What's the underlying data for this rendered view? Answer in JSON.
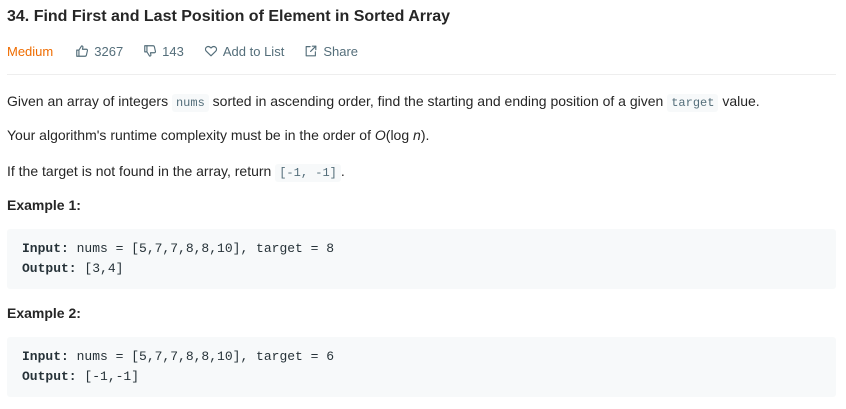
{
  "problem": {
    "title": "34. Find First and Last Position of Element in Sorted Array",
    "difficulty": "Medium",
    "likes": "3267",
    "dislikes": "143",
    "add_to_list": "Add to List",
    "share": "Share"
  },
  "description": {
    "p1": {
      "pre": "Given an array of integers ",
      "code1": "nums",
      "mid": " sorted in ascending order, find the starting and ending position of a given ",
      "code2": "target",
      "post": " value."
    },
    "p2": {
      "pre": "Your algorithm's runtime complexity must be in the order of ",
      "o": "O",
      "mid": "(log ",
      "n": "n",
      "post": ")."
    },
    "p3": {
      "pre": "If the target is not found in the array, return ",
      "code": "[-1, -1]",
      "post": "."
    }
  },
  "examples": [
    {
      "heading": "Example 1:",
      "input_label": "Input:",
      "input_value": " nums = [5,7,7,8,8,10], target = 8",
      "output_label": "Output:",
      "output_value": " [3,4]"
    },
    {
      "heading": "Example 2:",
      "input_label": "Input:",
      "input_value": " nums = [5,7,7,8,8,10], target = 6",
      "output_label": "Output:",
      "output_value": " [-1,-1]"
    }
  ],
  "colors": {
    "difficulty_medium": "#ef6c00",
    "meta_text": "#546e7a",
    "code_bg": "#f7f9fa"
  },
  "icons": {
    "likes": "thumbs-up-icon",
    "dislikes": "thumbs-down-icon",
    "add_to_list": "heart-icon",
    "share": "share-icon"
  }
}
